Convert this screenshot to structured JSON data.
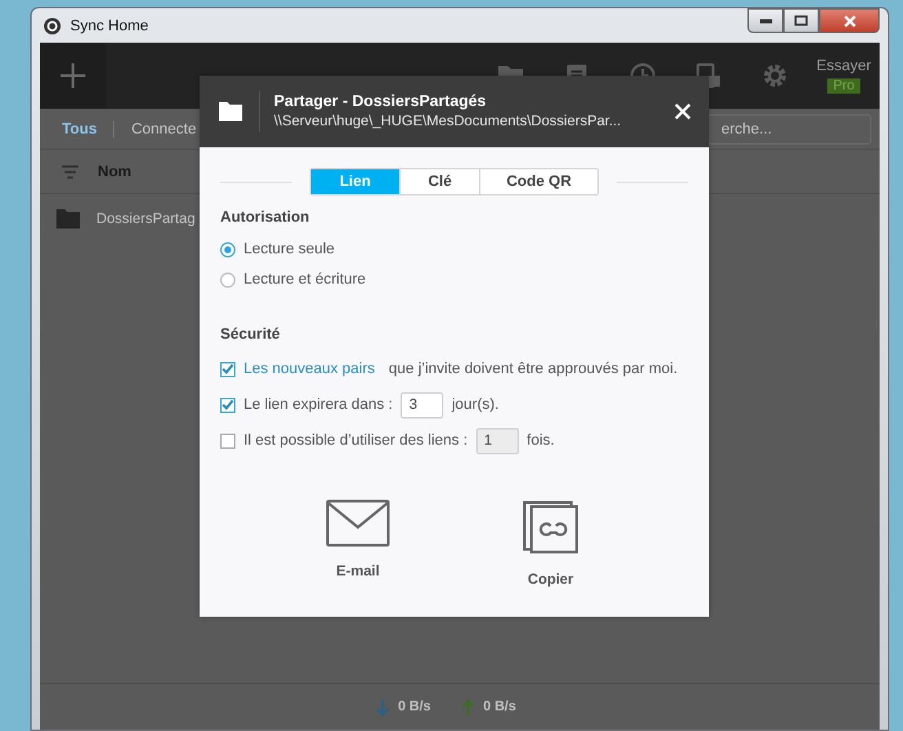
{
  "window": {
    "title": "Sync Home"
  },
  "toolbar": {
    "try_label": "Essayer",
    "pro_badge": "Pro"
  },
  "filters": [
    {
      "label": "Tous",
      "selected": true
    },
    {
      "label": "Connecte",
      "selected": false
    }
  ],
  "search": {
    "placeholder": "erche..."
  },
  "list": {
    "columns": [
      "Nom"
    ],
    "rows": [
      {
        "name": "DossiersPartag"
      }
    ]
  },
  "status_bar": {
    "download": "0 B/s",
    "upload": "0 B/s"
  },
  "dialog": {
    "title": "Partager - DossiersPartagés",
    "path": "\\\\Serveur\\huge\\_HUGE\\MesDocuments\\DossiersPar...",
    "tabs": [
      {
        "label": "Lien",
        "selected": true
      },
      {
        "label": "Clé",
        "selected": false
      },
      {
        "label": "Code QR",
        "selected": false
      }
    ],
    "permission": {
      "heading": "Autorisation",
      "options": [
        {
          "label": "Lecture seule",
          "selected": true
        },
        {
          "label": "Lecture et écriture",
          "selected": false
        }
      ]
    },
    "security": {
      "heading": "Sécurité",
      "options": [
        {
          "kind": "approval",
          "checked": true,
          "link": "Les nouveaux pairs",
          "text": "que j’invite doivent être approuvés par moi."
        },
        {
          "kind": "field",
          "checked": true,
          "text": "Le lien expirera dans :",
          "value": "3",
          "suffix": "jour(s)."
        },
        {
          "kind": "field",
          "checked": false,
          "text": "Il est possible d’utiliser des liens :",
          "value": "1",
          "suffix": "fois."
        }
      ]
    },
    "actions": [
      {
        "kind": "email",
        "label": "E-mail"
      },
      {
        "kind": "copy",
        "label": "Copier"
      }
    ]
  }
}
